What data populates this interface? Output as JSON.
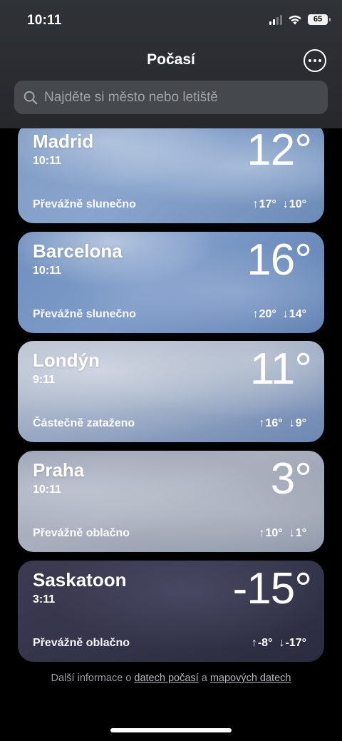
{
  "status": {
    "time": "10:11",
    "battery": "65"
  },
  "header": {
    "title": "Počasí"
  },
  "search": {
    "placeholder": "Najděte si město nebo letiště"
  },
  "cities": [
    {
      "name": "Madrid",
      "time": "10:11",
      "temp": "12°",
      "condition": "Převážně slunečno",
      "high": "17°",
      "low": "10°"
    },
    {
      "name": "Barcelona",
      "time": "10:11",
      "temp": "16°",
      "condition": "Převážně slunečno",
      "high": "20°",
      "low": "14°"
    },
    {
      "name": "Londýn",
      "time": "9:11",
      "temp": "11°",
      "condition": "Částečně zataženo",
      "high": "16°",
      "low": "9°"
    },
    {
      "name": "Praha",
      "time": "10:11",
      "temp": "3°",
      "condition": "Převážně oblačno",
      "high": "10°",
      "low": "1°"
    },
    {
      "name": "Saskatoon",
      "time": "3:11",
      "temp": "-15°",
      "condition": "Převážně oblačno",
      "high": "-8°",
      "low": "-17°"
    }
  ],
  "footer": {
    "prefix": "Další informace o ",
    "link1": "datech počasí",
    "middle": " a ",
    "link2": "mapových datech"
  },
  "icons": {
    "search": "search-icon",
    "more": "more-icon",
    "arrow_up": "arrow-up-icon",
    "arrow_down": "arrow-down-icon",
    "wifi": "wifi-icon",
    "signal": "cellular-signal-icon",
    "battery": "battery-icon"
  }
}
